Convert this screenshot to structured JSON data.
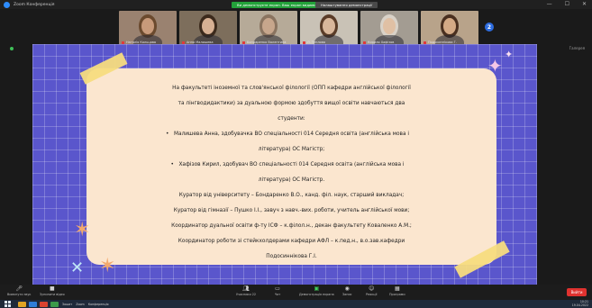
{
  "window": {
    "title": "Zoom Конференція",
    "share_banner": "Ви демонструєте екран. Ваш екран видимий",
    "share_settings": "Налаштування демонстрації"
  },
  "participants": [
    {
      "name": "Наталія Кольцова",
      "skin": "#c89a7a",
      "bg": "#9a8270",
      "hair": "#6b4a2e"
    },
    {
      "name": "Анна Малишева",
      "skin": "#d7b093",
      "bg": "#7d6e5c",
      "hair": "#3c2a1c"
    },
    {
      "name": "Бондаренко Валентина",
      "skin": "#c7a68c",
      "bg": "#b6aa98",
      "hair": "#8a7460"
    },
    {
      "name": "Л. Теплова",
      "skin": "#d9b79b",
      "bg": "#c9c2b6",
      "hair": "#5a3c28"
    },
    {
      "name": "Кирило Хафізов",
      "skin": "#e0c0a4",
      "bg": "#a39c92",
      "hair": "#d9d2c8"
    },
    {
      "name": "Подосиннікова Г.",
      "skin": "#d4aa86",
      "bg": "#b8a38a",
      "hair": "#4a3020"
    }
  ],
  "strip_next_count": "2",
  "view_label": "Галерея",
  "slide": {
    "paragraphs": [
      "На факультеті іноземної та слов'янської філології (ОПП кафедри англійської філології",
      "та лінгводидактики) за дуальною формою здобуття вищої освіти навчаються два",
      "студенти:"
    ],
    "bullets": [
      "Малишева Анна, здобувачка ВО спеціальності 014 Середня освіта (англійська мова і",
      "література) ОС Магістр;",
      "Хафізов Кирил, здобувач ВО спеціальності 014 Середня освіта (англійська мова і",
      "література) ОС Магістр."
    ],
    "closing": [
      "Куратор від університету – Бондаренко В.О., канд. філ. наук, старший викладач;",
      "Куратор від гімназії – Пушко І.І., завуч з навч.-вих. роботи, учитель англійської мови;",
      "Координатор дуальної освіти ф-ту ІСФ – к.філол.н., декан факультету Коваленко А.М.;",
      "Координатор роботи зі стейкхолдерами кафедри АФЛ – к.пед.н., в.о.зав.кафедри",
      "Подосиннікова Г.І."
    ]
  },
  "toolbar": {
    "mute": "Вимкнути звук",
    "video": "Зупинити відео",
    "participants": "Учасники",
    "participants_count": "22",
    "chat": "Чат",
    "share": "Демонстрація екрана",
    "record": "Запис",
    "reactions": "Реакції",
    "apps": "Програми",
    "leave": "Вийти"
  },
  "taskbar": {
    "apps": [
      "Зошит",
      "Zoom",
      "Конференція"
    ],
    "time": "10:21",
    "date": "19.04.2022"
  },
  "colors": {
    "slide_bg": "#5a56cc",
    "card": "#fbe6cf",
    "tape": "#f7dc7e",
    "share_banner": "#23a23a",
    "leave": "#e0322f"
  }
}
